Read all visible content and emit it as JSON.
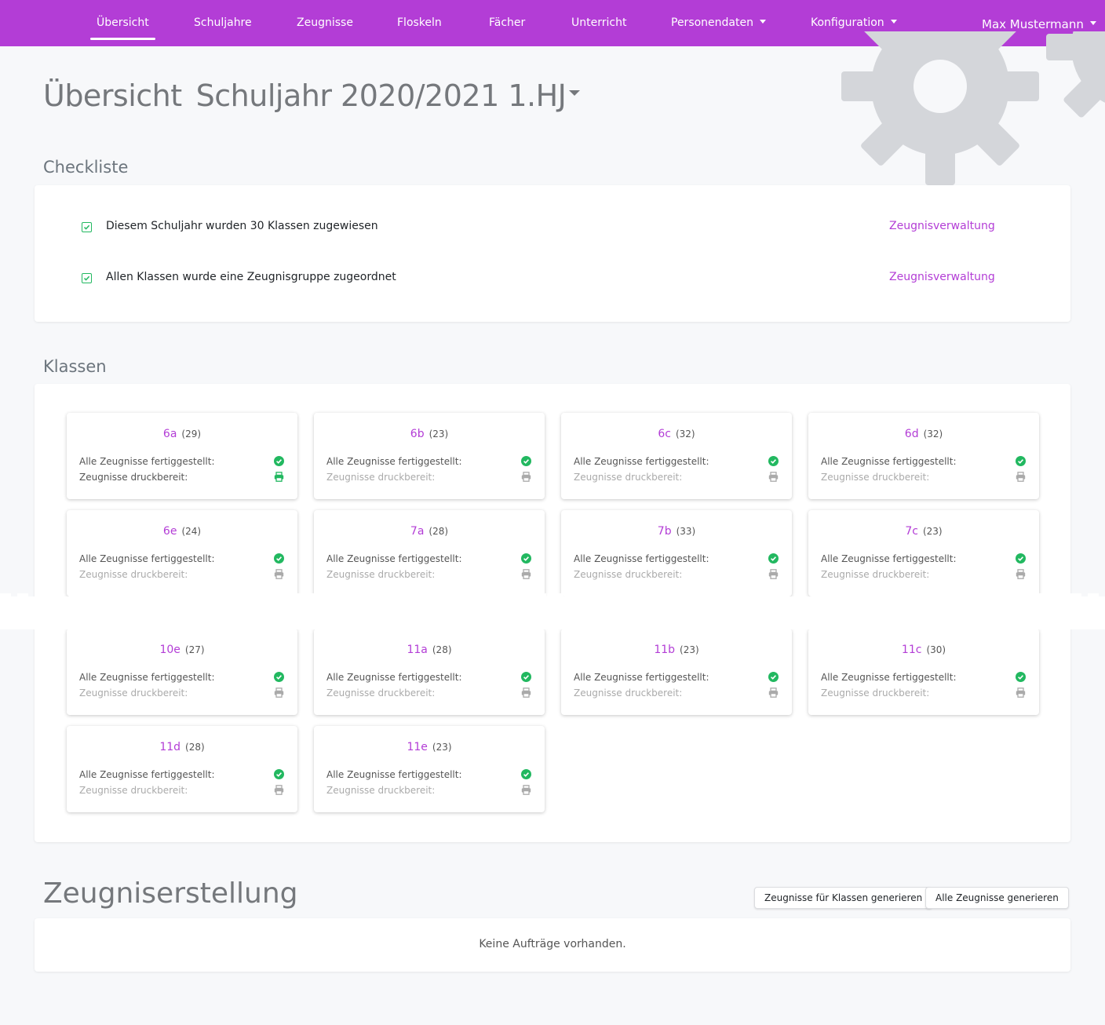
{
  "nav": {
    "items": [
      {
        "label": "Übersicht",
        "active": true,
        "dropdown": false
      },
      {
        "label": "Schuljahre",
        "active": false,
        "dropdown": false
      },
      {
        "label": "Zeugnisse",
        "active": false,
        "dropdown": false
      },
      {
        "label": "Floskeln",
        "active": false,
        "dropdown": false
      },
      {
        "label": "Fächer",
        "active": false,
        "dropdown": false
      },
      {
        "label": "Unterricht",
        "active": false,
        "dropdown": false
      },
      {
        "label": "Personendaten",
        "active": false,
        "dropdown": true
      },
      {
        "label": "Konfiguration",
        "active": false,
        "dropdown": true
      }
    ],
    "user": "Max Mustermann"
  },
  "header": {
    "title": "Übersicht",
    "schoolyear": "Schuljahr 2020/2021 1.HJ"
  },
  "checklist": {
    "title": "Checkliste",
    "items": [
      {
        "text": "Diesem Schuljahr wurden 30 Klassen zugewiesen",
        "link": "Zeugnisverwaltung",
        "checked": true
      },
      {
        "text": "Allen Klassen wurde eine Zeugnisgruppe zugeordnet",
        "link": "Zeugnisverwaltung",
        "checked": true
      }
    ]
  },
  "classes": {
    "title": "Klassen",
    "completed_label": "Alle Zeugnisse fertiggestellt:",
    "printable_label": "Zeugnisse druckbereit:",
    "items": [
      {
        "name": "6a",
        "count": "(29)",
        "completed": true,
        "printable": true
      },
      {
        "name": "6b",
        "count": "(23)",
        "completed": true,
        "printable": false
      },
      {
        "name": "6c",
        "count": "(32)",
        "completed": true,
        "printable": false
      },
      {
        "name": "6d",
        "count": "(32)",
        "completed": true,
        "printable": false
      },
      {
        "name": "6e",
        "count": "(24)",
        "completed": true,
        "printable": false
      },
      {
        "name": "7a",
        "count": "(28)",
        "completed": true,
        "printable": false
      },
      {
        "name": "7b",
        "count": "(33)",
        "completed": true,
        "printable": false
      },
      {
        "name": "7c",
        "count": "(23)",
        "completed": true,
        "printable": false
      },
      {
        "name": "10e",
        "count": "(27)",
        "completed": true,
        "printable": false
      },
      {
        "name": "11a",
        "count": "(28)",
        "completed": true,
        "printable": false
      },
      {
        "name": "11b",
        "count": "(23)",
        "completed": true,
        "printable": false
      },
      {
        "name": "11c",
        "count": "(30)",
        "completed": true,
        "printable": false
      },
      {
        "name": "11d",
        "count": "(28)",
        "completed": true,
        "printable": false
      },
      {
        "name": "11e",
        "count": "(23)",
        "completed": true,
        "printable": false
      }
    ]
  },
  "generation": {
    "title": "Zeugniserstellung",
    "btn_classes": "Zeugnisse für Klassen generieren",
    "btn_all": "Alle Zeugnisse generieren",
    "empty": "Keine Aufträge vorhanden."
  },
  "colors": {
    "brand": "#b33dd6",
    "success": "#22b860",
    "muted_icon": "#aaaaaa"
  }
}
